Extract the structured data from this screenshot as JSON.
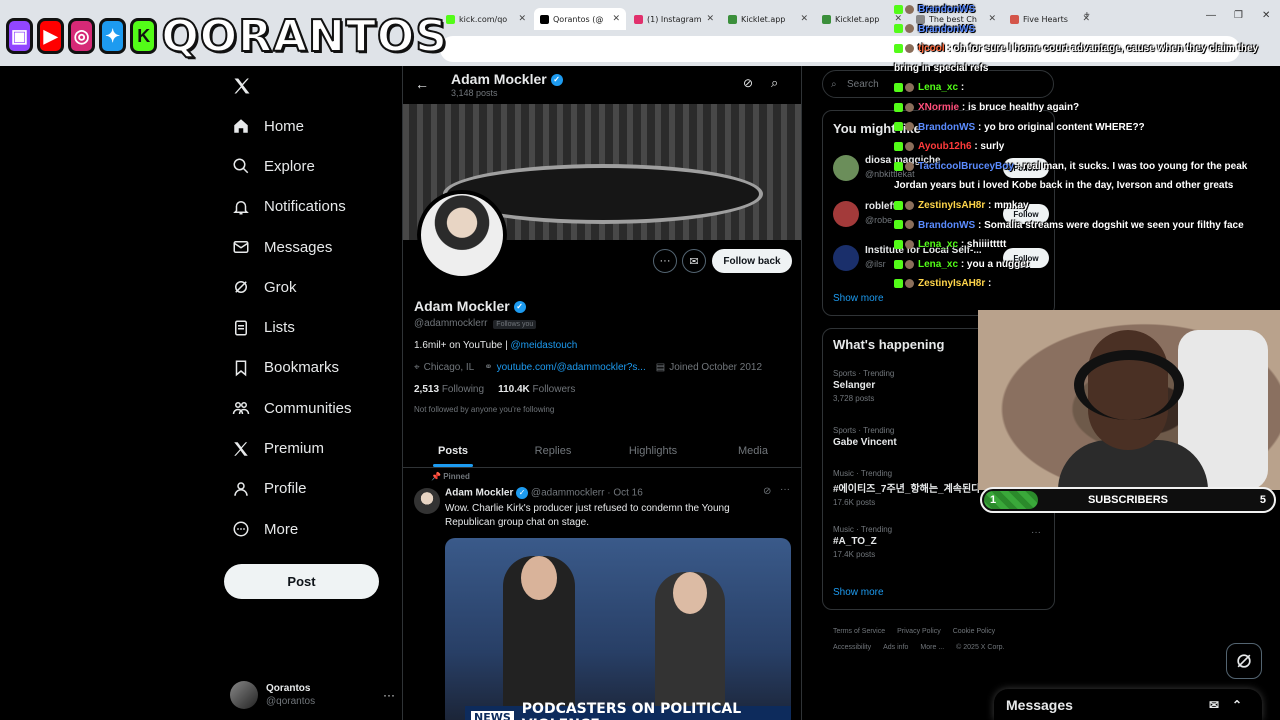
{
  "browser": {
    "tabs": [
      {
        "title": "kick.com/qo",
        "color": "#53fc18"
      },
      {
        "title": "Qorantos (@",
        "color": "#000000"
      },
      {
        "title": "(1) Instagram",
        "color": "#e1306c"
      },
      {
        "title": "Kicklet.app",
        "color": "#3b8f3b"
      },
      {
        "title": "Kicklet.app",
        "color": "#3b8f3b"
      },
      {
        "title": "The best Ch",
        "color": "#888888"
      },
      {
        "title": "Five Hearts",
        "color": "#d4554a"
      }
    ]
  },
  "overlay": {
    "brand": "QORANTOS",
    "icons": [
      "twitch-icon",
      "youtube-icon",
      "instagram-icon",
      "twitter-icon",
      "kick-icon"
    ]
  },
  "nav": {
    "items": [
      {
        "label": "Home",
        "icon": "home-icon"
      },
      {
        "label": "Explore",
        "icon": "search-icon"
      },
      {
        "label": "Notifications",
        "icon": "bell-icon"
      },
      {
        "label": "Messages",
        "icon": "mail-icon"
      },
      {
        "label": "Grok",
        "icon": "grok-icon"
      },
      {
        "label": "Lists",
        "icon": "list-icon"
      },
      {
        "label": "Bookmarks",
        "icon": "bookmark-icon"
      },
      {
        "label": "Communities",
        "icon": "communities-icon"
      },
      {
        "label": "Premium",
        "icon": "x-icon"
      },
      {
        "label": "Profile",
        "icon": "person-icon"
      },
      {
        "label": "More",
        "icon": "more-icon"
      }
    ],
    "post_label": "Post",
    "account": {
      "name": "Qorantos",
      "handle": "@qorantos"
    }
  },
  "profile": {
    "header_name": "Adam Mockler",
    "header_posts": "3,148 posts",
    "name": "Adam Mockler",
    "handle": "@adammocklerr",
    "follows_you": "Follows you",
    "follow_back": "Follow back",
    "bio_text": "1.6mil+ on YouTube | ",
    "bio_link": "@meidastouch",
    "location": "Chicago, IL",
    "website": "youtube.com/@adammockler?s...",
    "joined": "Joined October 2012",
    "following_count": "2,513",
    "following_label": "Following",
    "followers_count": "110.4K",
    "followers_label": "Followers",
    "not_followed": "Not followed by anyone you're following",
    "tabs": [
      "Posts",
      "Replies",
      "Highlights",
      "Media"
    ]
  },
  "post": {
    "pinned": "Pinned",
    "author": "Adam Mockler",
    "handle": "@adammocklerr",
    "date": "· Oct 16",
    "text": "Wow. Charlie Kirk's producer just refused to condemn the Young Republican group chat on stage.",
    "media_news": "NEWS",
    "media_caption": "PODCASTERS ON POLITICAL VIOLENCE"
  },
  "sidebar": {
    "search_placeholder": "Search",
    "who_title": "You might like",
    "who": [
      {
        "name": "diosa maggiche",
        "handle": "@nbkittlekat",
        "btn": "Follow"
      },
      {
        "name": "robleft",
        "handle": "@robe",
        "btn": "Follow"
      },
      {
        "name": "Institute for Local Self-...",
        "handle": "@ilsr",
        "btn": "Follow"
      }
    ],
    "show_more": "Show more",
    "happening_title": "What's happening",
    "trends": [
      {
        "label": "Sports · Trending",
        "name": "Selanger",
        "count": "3,728 posts"
      },
      {
        "label": "Sports · Trending",
        "name": "Gabe Vincent",
        "count": ""
      },
      {
        "label": "Music · Trending",
        "name": "#에이티즈_7주년_항해는_계속된다",
        "count": "17.6K posts"
      },
      {
        "label": "Music · Trending",
        "name": "#A_TO_Z",
        "count": "17.4K posts"
      }
    ],
    "show_more2": "Show more",
    "footer": [
      "Terms of Service",
      "Privacy Policy",
      "Cookie Policy",
      "Accessibility",
      "Ads info",
      "More ...",
      "© 2025 X Corp."
    ]
  },
  "chat": [
    {
      "user": "BrandonWS",
      "color": "#5b8cff",
      "msg": ""
    },
    {
      "user": "BrandonWS",
      "color": "#5b8cff",
      "msg": ""
    },
    {
      "user": "tjcool",
      "color": "#ff6a3d",
      "msg": ": oh for sure l home court advantage, cause when they claim they"
    },
    {
      "user": "",
      "color": "#ffffff",
      "msg": "bring in special refs"
    },
    {
      "user": "Lena_xc",
      "color": "#53fc18",
      "msg": ":"
    },
    {
      "user": "XNormie",
      "color": "#ff4f7b",
      "msg": ": is bruce healthy again?"
    },
    {
      "user": "BrandonWS",
      "color": "#5b8cff",
      "msg": ": yo bro original content WHERE??"
    },
    {
      "user": "Ayoub12h6",
      "color": "#ff3b3b",
      "msg": ": surly"
    },
    {
      "user": "TacticoolBruceyBoy",
      "color": "#5b8cff",
      "msg": ": real man, it sucks. I was too young for the peak"
    },
    {
      "user": "",
      "color": "#ffffff",
      "msg": "Jordan years but i loved Kobe back in the day, Iverson and other greats"
    },
    {
      "user": "ZestinyIsAH8r",
      "color": "#ffd54a",
      "msg": ": mmkay"
    },
    {
      "user": "BrandonWS",
      "color": "#5b8cff",
      "msg": ": Somalia streams were dogshit we seen your filthy face"
    },
    {
      "user": "Lena_xc",
      "color": "#53fc18",
      "msg": ": shiiiittttt"
    },
    {
      "user": "Lena_xc",
      "color": "#53fc18",
      "msg": ": you a nugget"
    },
    {
      "user": "ZestinyIsAH8r",
      "color": "#ffd54a",
      "msg": ":"
    }
  ],
  "subgoal": {
    "current": "1",
    "label": "SUBSCRIBERS",
    "target": "5",
    "progress": 0.2
  },
  "messages_dock": {
    "label": "Messages"
  }
}
